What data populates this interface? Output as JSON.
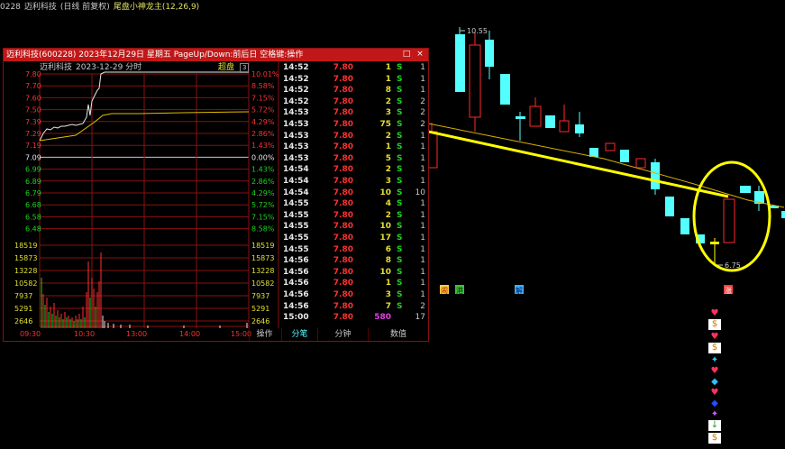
{
  "topbar": {
    "code": "0228",
    "name": "迈利科技",
    "mode": "(日线 前复权)",
    "indicator": "尾盘小神龙主(12,26,9)"
  },
  "popup": {
    "title": "迈利科技(600228)  2023年12月29日  星期五  PageUp/Down:前后日  空格键:操作",
    "intraday_name": "迈利科技",
    "intraday_date": "2023-12-29 分时",
    "overlay_label": "超盘",
    "overlay_key": "3",
    "price_labels": [
      "7.80",
      "7.70",
      "7.60",
      "7.50",
      "7.39",
      "7.29",
      "7.19",
      "7.09",
      "6.99",
      "6.89",
      "6.79",
      "6.68",
      "6.58",
      "6.48"
    ],
    "pct_labels": [
      "10.01%",
      "8.58%",
      "7.15%",
      "5.72%",
      "4.29%",
      "2.86%",
      "1.43%",
      "0.00%",
      "1.43%",
      "2.86%",
      "4.29%",
      "5.72%",
      "7.15%",
      "8.58%"
    ],
    "vol_labels": [
      "18519",
      "15873",
      "13228",
      "10582",
      "7937",
      "5291",
      "2646"
    ],
    "time_labels": [
      "09:30",
      "10:30",
      "13:00",
      "14:00",
      "15:00"
    ],
    "ticks": [
      {
        "time": "14:52",
        "price": "7.80",
        "vol": "1",
        "bs": "S",
        "cnt": "1"
      },
      {
        "time": "14:52",
        "price": "7.80",
        "vol": "1",
        "bs": "S",
        "cnt": "1"
      },
      {
        "time": "14:52",
        "price": "7.80",
        "vol": "8",
        "bs": "S",
        "cnt": "1"
      },
      {
        "time": "14:52",
        "price": "7.80",
        "vol": "2",
        "bs": "S",
        "cnt": "2"
      },
      {
        "time": "14:53",
        "price": "7.80",
        "vol": "3",
        "bs": "S",
        "cnt": "2"
      },
      {
        "time": "14:53",
        "price": "7.80",
        "vol": "75",
        "bs": "S",
        "cnt": "2"
      },
      {
        "time": "14:53",
        "price": "7.80",
        "vol": "2",
        "bs": "S",
        "cnt": "1"
      },
      {
        "time": "14:53",
        "price": "7.80",
        "vol": "1",
        "bs": "S",
        "cnt": "1"
      },
      {
        "time": "14:53",
        "price": "7.80",
        "vol": "5",
        "bs": "S",
        "cnt": "1"
      },
      {
        "time": "14:54",
        "price": "7.80",
        "vol": "2",
        "bs": "S",
        "cnt": "1"
      },
      {
        "time": "14:54",
        "price": "7.80",
        "vol": "3",
        "bs": "S",
        "cnt": "1"
      },
      {
        "time": "14:54",
        "price": "7.80",
        "vol": "10",
        "bs": "S",
        "cnt": "10"
      },
      {
        "time": "14:55",
        "price": "7.80",
        "vol": "4",
        "bs": "S",
        "cnt": "1"
      },
      {
        "time": "14:55",
        "price": "7.80",
        "vol": "2",
        "bs": "S",
        "cnt": "1"
      },
      {
        "time": "14:55",
        "price": "7.80",
        "vol": "10",
        "bs": "S",
        "cnt": "1"
      },
      {
        "time": "14:55",
        "price": "7.80",
        "vol": "17",
        "bs": "S",
        "cnt": "1"
      },
      {
        "time": "14:55",
        "price": "7.80",
        "vol": "6",
        "bs": "S",
        "cnt": "1"
      },
      {
        "time": "14:56",
        "price": "7.80",
        "vol": "8",
        "bs": "S",
        "cnt": "1"
      },
      {
        "time": "14:56",
        "price": "7.80",
        "vol": "10",
        "bs": "S",
        "cnt": "1"
      },
      {
        "time": "14:56",
        "price": "7.80",
        "vol": "1",
        "bs": "S",
        "cnt": "1"
      },
      {
        "time": "14:56",
        "price": "7.80",
        "vol": "3",
        "bs": "S",
        "cnt": "1"
      },
      {
        "time": "14:56",
        "price": "7.80",
        "vol": "7",
        "bs": "S",
        "cnt": "2"
      },
      {
        "time": "15:00",
        "price": "7.80",
        "vol": "580",
        "bs": "",
        "cnt": "17"
      }
    ],
    "tabs": [
      "操作",
      "分笔",
      "分钟",
      "数值"
    ]
  },
  "kline": {
    "high_label": "10.55",
    "low_label": "6.75",
    "markers": [
      "闹",
      "港",
      "解",
      "涨"
    ]
  },
  "colors": {
    "up": "#ff2a2a",
    "down": "#54ffff",
    "accent": "#ffff00",
    "grid": "#8a1010"
  }
}
